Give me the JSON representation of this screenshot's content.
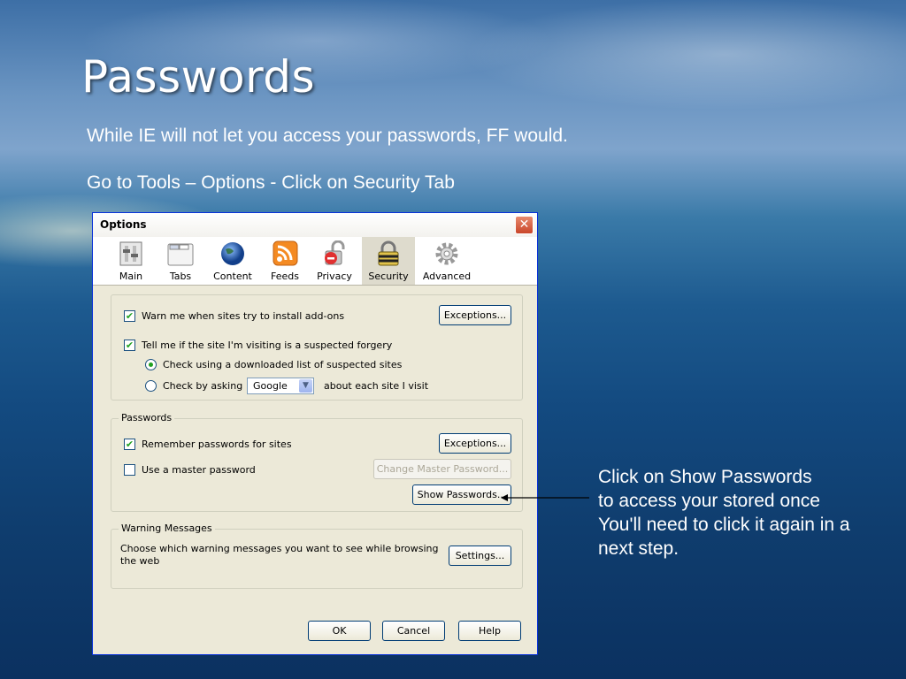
{
  "slide": {
    "title": "Passwords",
    "line1": "While IE will not let you access your passwords, FF would.",
    "line2": "Go to Tools – Options -  Click on Security Tab",
    "callout": "Click on Show Passwords\n to access your stored once\nYou'll need to click it again in a next step."
  },
  "dialog": {
    "title": "Options",
    "close_label": "✕",
    "tabs": [
      {
        "label": "Main",
        "icon": "switch-icon"
      },
      {
        "label": "Tabs",
        "icon": "tabs-window-icon"
      },
      {
        "label": "Content",
        "icon": "globe-icon"
      },
      {
        "label": "Feeds",
        "icon": "rss-feed-icon"
      },
      {
        "label": "Privacy",
        "icon": "privacy-lock-icon"
      },
      {
        "label": "Security",
        "icon": "security-padlock-icon"
      },
      {
        "label": "Advanced",
        "icon": "gear-icon"
      }
    ],
    "selected_tab": "Security",
    "general": {
      "warn_addons": "Warn me when sites try to install add-ons",
      "warn_addons_checked": true,
      "exceptions": "Exceptions...",
      "forgery": "Tell me if the site I'm visiting is a suspected forgery",
      "forgery_checked": true,
      "radio_download": "Check using a downloaded list of suspected sites",
      "radio_ask": "Check by asking",
      "provider": "Google",
      "about_each": "about each site I visit"
    },
    "passwords": {
      "legend": "Passwords",
      "remember": "Remember passwords for sites",
      "remember_checked": true,
      "exceptions": "Exceptions...",
      "master": "Use a master password",
      "master_checked": false,
      "change_master": "Change Master Password...",
      "show": "Show Passwords..."
    },
    "warnings": {
      "legend": "Warning Messages",
      "text": "Choose which warning messages you want to see while browsing the web",
      "settings": "Settings..."
    },
    "footer": {
      "ok": "OK",
      "cancel": "Cancel",
      "help": "Help"
    }
  },
  "colors": {
    "accent": "#0831d9",
    "check": "#21a121",
    "dialog_bg": "#ece9d8"
  }
}
